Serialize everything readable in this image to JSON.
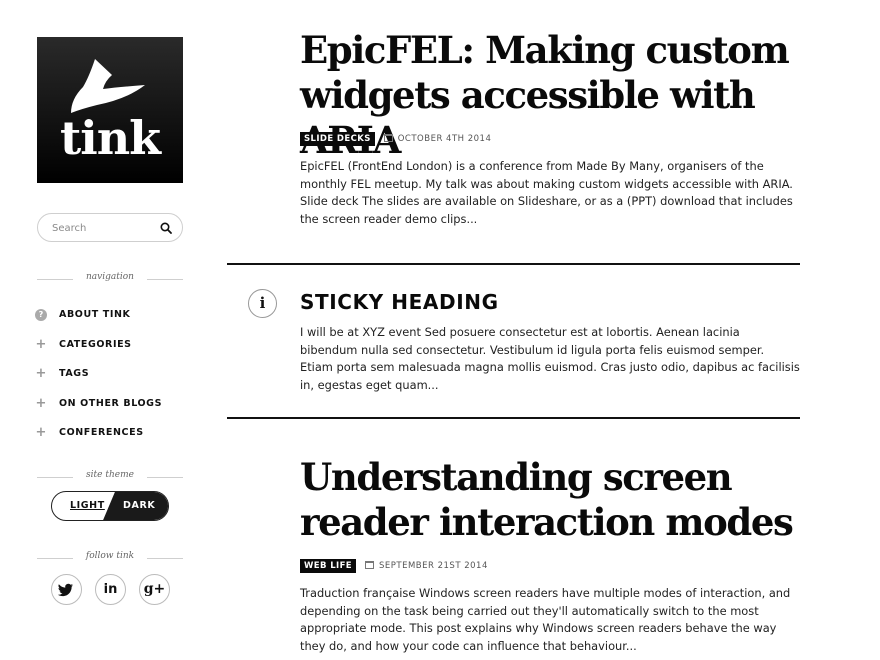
{
  "sidebar": {
    "logo_text": "tink",
    "search_placeholder": "Search",
    "navigation_heading": "navigation",
    "nav_items": [
      {
        "label": "ABOUT TINK",
        "icon": "question-icon"
      },
      {
        "label": "CATEGORIES",
        "icon": "plus-icon"
      },
      {
        "label": "TAGS",
        "icon": "plus-icon"
      },
      {
        "label": "ON OTHER BLOGS",
        "icon": "plus-icon"
      },
      {
        "label": "CONFERENCES",
        "icon": "plus-icon"
      }
    ],
    "theme_heading": "site theme",
    "theme_options": {
      "light": "LIGHT",
      "dark": "DARK",
      "selected": "dark"
    },
    "follow_heading": "follow tink",
    "social": [
      {
        "name": "twitter",
        "glyph": "🐦"
      },
      {
        "name": "linkedin",
        "glyph": "in"
      },
      {
        "name": "google-plus",
        "glyph": "g+"
      }
    ]
  },
  "posts": [
    {
      "title": "EpicFEL: Making custom widgets accessible with ARIA",
      "category": "SLIDE DECKS",
      "date": "OCTOBER 4TH 2014",
      "excerpt": "EpicFEL (FrontEnd London) is a conference from Made By Many, organisers of the monthly FEL meetup. My talk was about making custom widgets accessible with ARIA. Slide deck The slides are available on Slideshare, or as a (PPT) download that includes the screen reader demo clips..."
    },
    {
      "title": "Understanding screen reader interaction modes",
      "category": "WEB LIFE",
      "date": "SEPTEMBER 21ST 2014",
      "excerpt": "Traduction française Windows screen readers have multiple modes of interaction, and depending on the task being carried out they'll automatically switch to the most appropriate mode. This post explains why Windows screen readers behave the way they do, and how your code can influence that behaviour..."
    }
  ],
  "sticky": {
    "icon": "info-icon",
    "glyph": "i",
    "title": "STICKY HEADING",
    "text": "I will be at XYZ event Sed posuere consectetur est at lobortis. Aenean lacinia bibendum nulla sed consectetur. Vestibulum id ligula porta felis euismod semper. Etiam porta sem malesuada magna mollis euismod. Cras justo odio, dapibus ac facilisis in, egestas eget quam..."
  }
}
